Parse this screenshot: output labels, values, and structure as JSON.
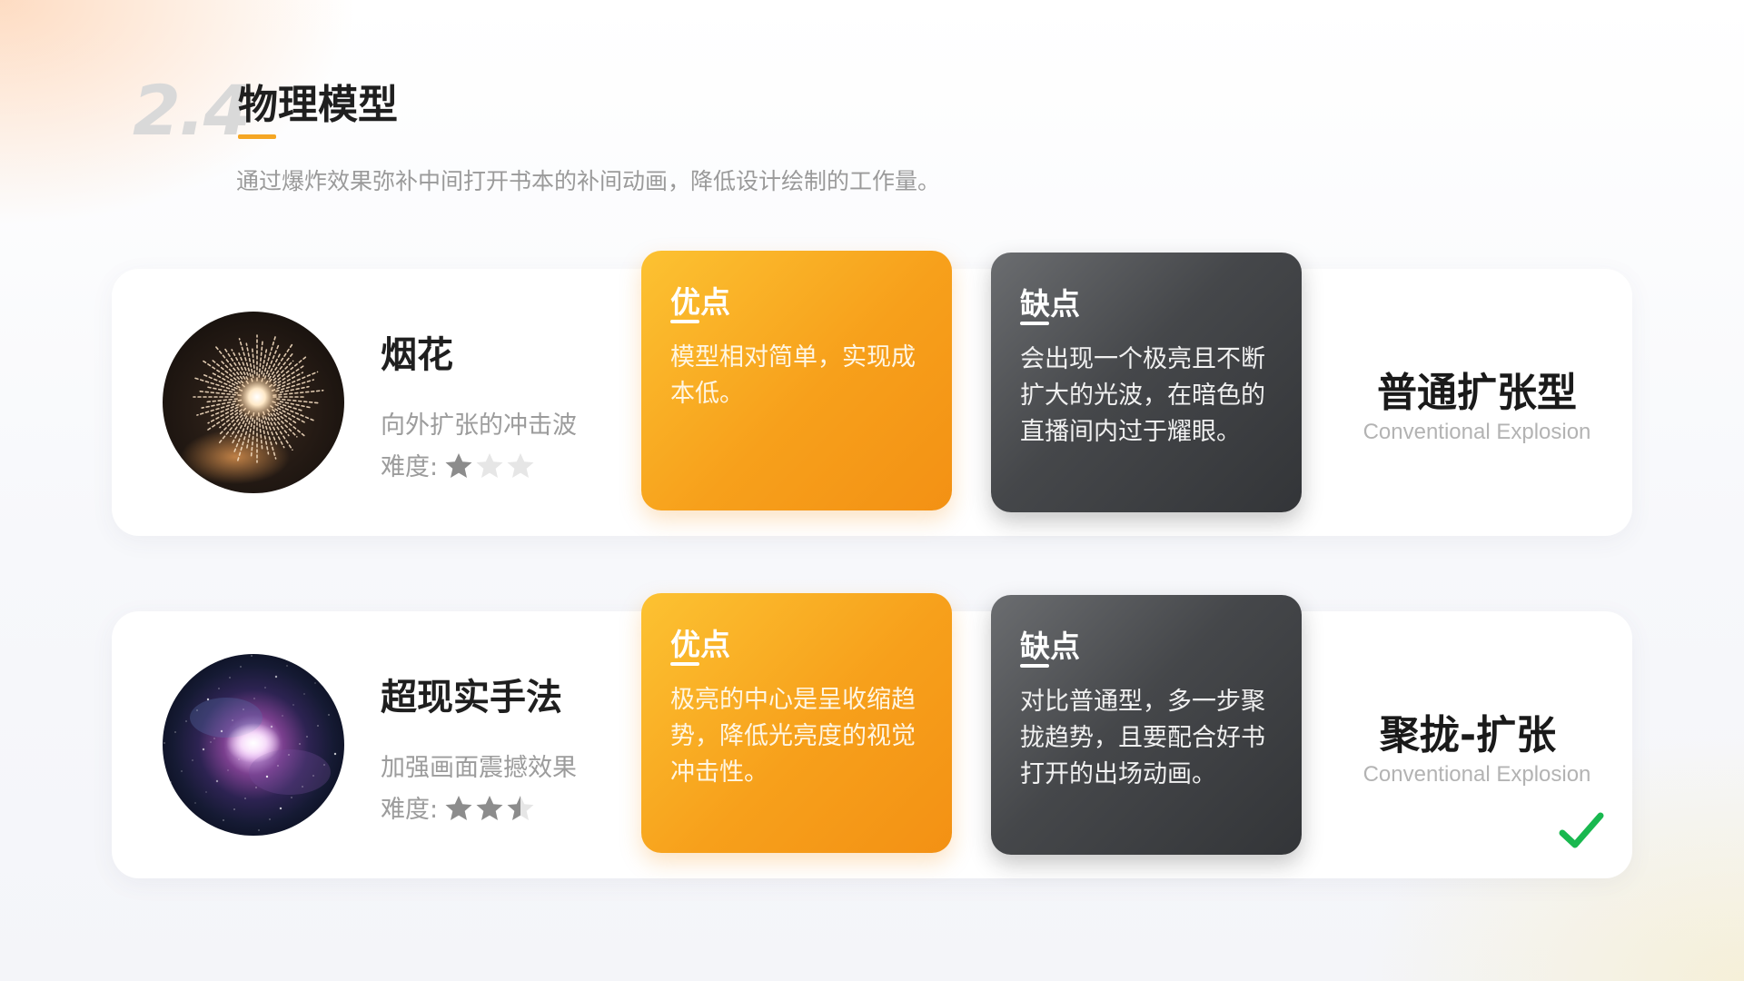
{
  "header": {
    "number": "2.4",
    "title": "物理模型",
    "subtitle": "通过爆炸效果弥补中间打开书本的补间动画，降低设计绘制的工作量。"
  },
  "rows": [
    {
      "image": "fireworks-photo",
      "name": "烟花",
      "description": "向外扩张的冲击波",
      "difficulty_label": "难度:",
      "difficulty_stars": 1,
      "pros": {
        "title": "优点",
        "text": "模型相对简单，实现成本低。"
      },
      "cons": {
        "title": "缺点",
        "text": "会出现一个极亮且不断扩大的光波，在暗色的直播间内过于耀眼。"
      },
      "type_title": "普通扩张型",
      "type_subtitle": "Conventional Explosion",
      "selected": false
    },
    {
      "image": "nebula-photo",
      "name": "超现实手法",
      "description": "加强画面震撼效果",
      "difficulty_label": "难度:",
      "difficulty_stars": 2.5,
      "pros": {
        "title": "优点",
        "text": "极亮的中心是呈收缩趋势，降低光亮度的视觉冲击性。"
      },
      "cons": {
        "title": "缺点",
        "text": "对比普通型，多一步聚拢趋势，且要配合好书打开的出场动画。"
      },
      "type_title": "聚拢-扩张",
      "type_subtitle": "Conventional Explosion",
      "selected": true
    }
  ],
  "colors": {
    "accent": "#f5a623",
    "pros_gradient": [
      "#fcc232",
      "#f39114"
    ],
    "cons_gradient": [
      "#6b6d70",
      "#333538"
    ],
    "check": "#19b84f",
    "star_filled": "#8c8c8c",
    "star_empty": "#e6e6e6"
  },
  "icons": {
    "star": "star-icon",
    "check": "checkmark-icon"
  }
}
